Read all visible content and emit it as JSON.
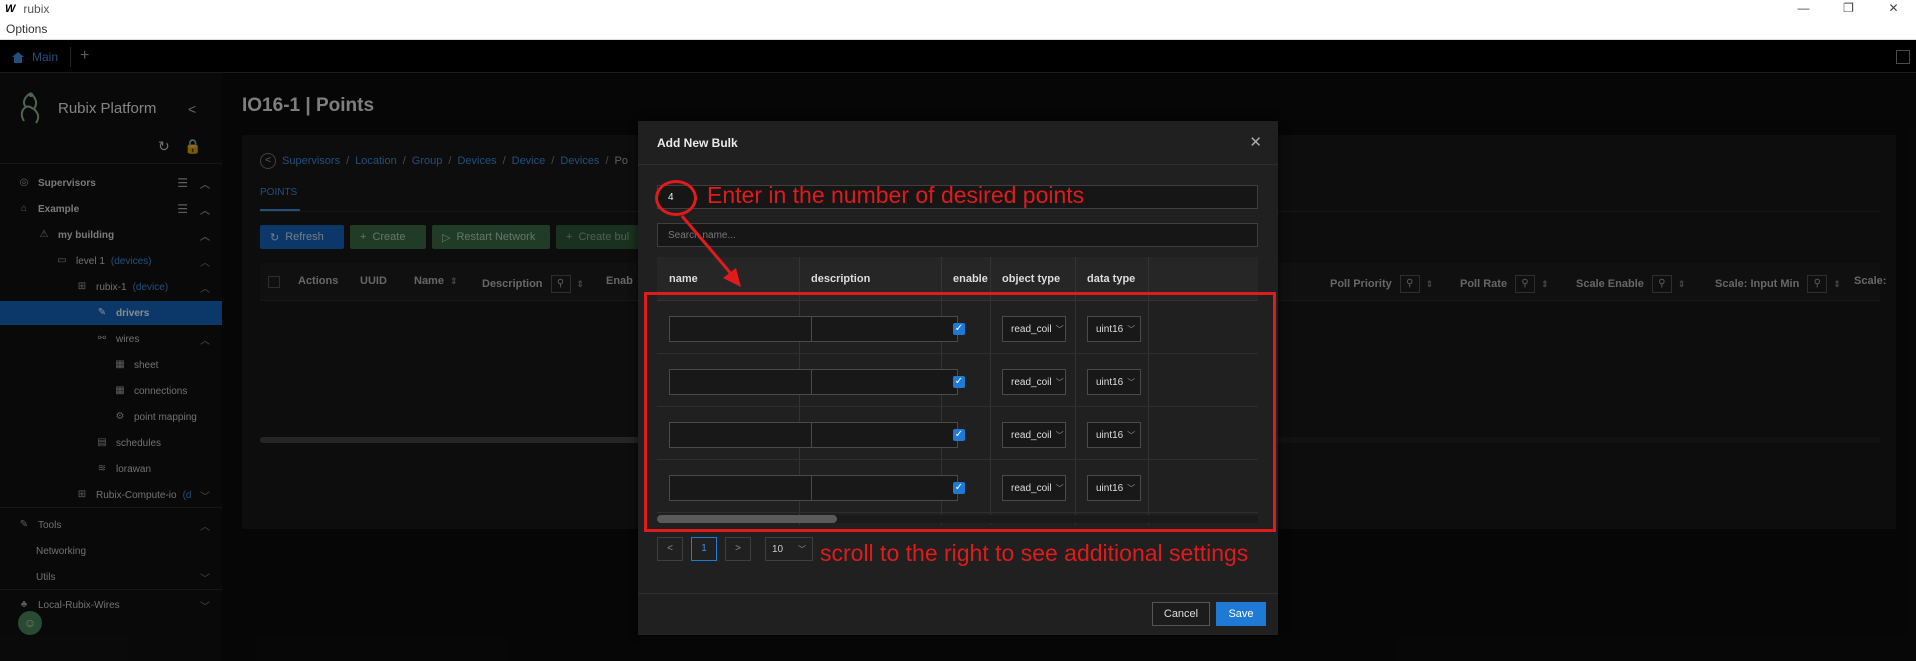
{
  "window": {
    "logo": "W",
    "title": "rubix",
    "minimize": "—",
    "restore": "❐",
    "close": "✕"
  },
  "menubar": {
    "options": "Options"
  },
  "tabs": {
    "main": "Main",
    "add": "+"
  },
  "sidebar": {
    "brand": "Rubix Platform",
    "collapse": "<",
    "items": [
      {
        "label": "Supervisors",
        "tag": ""
      },
      {
        "label": "Example",
        "tag": ""
      },
      {
        "label": "my building",
        "tag": ""
      },
      {
        "label": "level 1",
        "tag": "(devices)"
      },
      {
        "label": "rubix-1",
        "tag": "(device)"
      },
      {
        "label": "drivers",
        "tag": ""
      },
      {
        "label": "wires",
        "tag": ""
      },
      {
        "label": "sheet",
        "tag": ""
      },
      {
        "label": "connections",
        "tag": ""
      },
      {
        "label": "point mapping",
        "tag": ""
      },
      {
        "label": "schedules",
        "tag": ""
      },
      {
        "label": "lorawan",
        "tag": ""
      },
      {
        "label": "Rubix-Compute-io",
        "tag": "(d"
      },
      {
        "label": "Tools",
        "tag": ""
      },
      {
        "label": "Networking",
        "tag": ""
      },
      {
        "label": "Utils",
        "tag": ""
      },
      {
        "label": "Local-Rubix-Wires",
        "tag": ""
      }
    ]
  },
  "page": {
    "title": "IO16-1 | Points",
    "breadcrumb": [
      "Supervisors",
      "Location",
      "Group",
      "Devices",
      "Device",
      "Devices",
      "Po"
    ],
    "tab": "POINTS",
    "buttons": {
      "refresh": "Refresh",
      "create": "Create",
      "restart": "Restart Network",
      "create_bulk": "Create bul"
    },
    "columns": [
      "Actions",
      "UUID",
      "Name",
      "Description",
      "Enab",
      "Poll Priority",
      "Poll Rate",
      "Scale Enable",
      "Scale: Input Min",
      "Scale:"
    ]
  },
  "modal": {
    "title": "Add New Bulk",
    "close": "✕",
    "count_value": "4",
    "search_placeholder": "Search name...",
    "columns": [
      "name",
      "description",
      "enable",
      "object type",
      "data type"
    ],
    "rows": [
      {
        "object_type": "read_coil",
        "data_type": "uint16",
        "enabled": true
      },
      {
        "object_type": "read_coil",
        "data_type": "uint16",
        "enabled": true
      },
      {
        "object_type": "read_coil",
        "data_type": "uint16",
        "enabled": true
      },
      {
        "object_type": "read_coil",
        "data_type": "uint16",
        "enabled": true
      }
    ],
    "pager": {
      "prev": "<",
      "page": "1",
      "next": ">",
      "size": "10"
    },
    "cancel": "Cancel",
    "save": "Save"
  },
  "annotations": {
    "count_hint": "Enter in the number of desired points",
    "scroll_hint": "scroll to the right to see additional settings",
    "color": "#e01b1b"
  }
}
